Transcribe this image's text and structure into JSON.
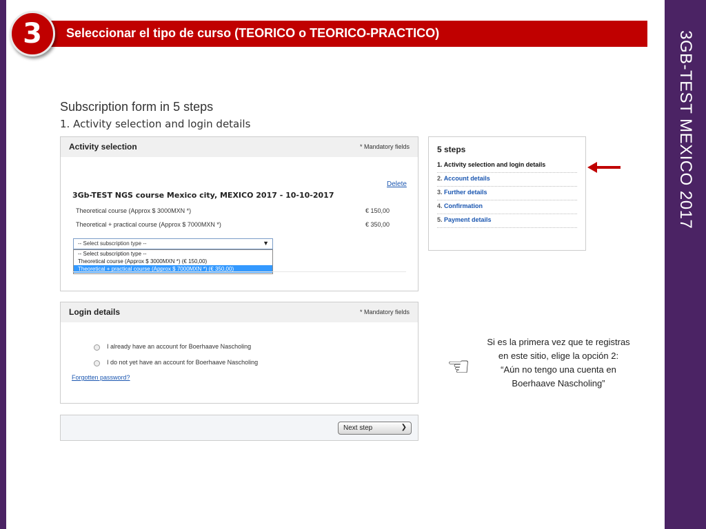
{
  "slide": {
    "badge_text": "3",
    "header_title": "Seleccionar el tipo de curso (TEORICO  o TEORICO-PRACTICO)",
    "side_title": "3GB-TEST MEXICO 2017"
  },
  "form": {
    "title": "Subscription form in 5 steps",
    "step_heading": "1. Activity selection and login details",
    "activity": {
      "heading": "Activity selection",
      "mandatory": "* Mandatory fields",
      "delete_link": "Delete",
      "course_title": "3Gb-TEST NGS course Mexico city, MEXICO 2017 - 10-10-2017",
      "options": [
        {
          "label": "Theoretical course (Approx $ 3000MXN *)",
          "price": "€ 150,00"
        },
        {
          "label": "Theoretical + practical course (Approx $ 7000MXN *)",
          "price": "€ 350,00"
        }
      ],
      "select_value": "-- Select subscription type --",
      "dropdown_options": [
        "-- Select subscription type --",
        "Theoretical course (Approx $ 3000MXN *) (€ 150,00)",
        "Theoretical + practical course (Approx $ 7000MXN *) (€ 350,00)"
      ]
    },
    "login": {
      "heading": "Login details",
      "mandatory": "* Mandatory fields",
      "radio_1": "I already have an account for Boerhaave Nascholing",
      "radio_2": "I do not yet have an account for Boerhaave Nascholing",
      "forgot_link": "Forgotten password?"
    },
    "next_button": "Next step",
    "next_icon": "chevron-right-icon"
  },
  "steps_box": {
    "title": "5 steps",
    "items": [
      {
        "num": "1.",
        "label": "Activity selection and login details"
      },
      {
        "num": "2.",
        "label": "Account details"
      },
      {
        "num": "3.",
        "label": "Further details"
      },
      {
        "num": "4.",
        "label": "Confirmation"
      },
      {
        "num": "5.",
        "label": "Payment details"
      }
    ]
  },
  "note": {
    "line1": "Si es la primera vez que te registras en este sitio, elige la opción 2:",
    "line2": "“Aún no tengo una cuenta en Boerhaave Nascholing”",
    "icon": "pointing-hand-icon"
  },
  "colors": {
    "accent_red": "#c00000",
    "purple_bar": "#4b2364",
    "link_blue": "#1a56b0",
    "selection_blue": "#3399ff"
  }
}
